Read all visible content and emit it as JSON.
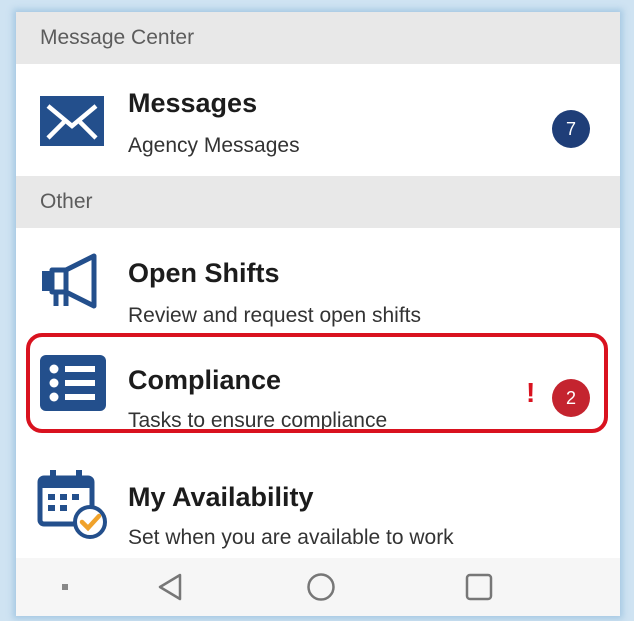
{
  "sections": {
    "message_center": "Message Center",
    "other": "Other"
  },
  "items": {
    "messages": {
      "title": "Messages",
      "subtitle": "Agency Messages",
      "badge": "7",
      "icon": "envelope-icon"
    },
    "open_shifts": {
      "title": "Open Shifts",
      "subtitle": "Review and request open shifts",
      "icon": "megaphone-icon"
    },
    "compliance": {
      "title": "Compliance",
      "subtitle": "Tasks to ensure compliance",
      "alert": "!",
      "badge": "2",
      "icon": "list-icon"
    },
    "availability": {
      "title": "My Availability",
      "subtitle": "Set when you are available to work",
      "icon": "calendar-check-icon"
    }
  },
  "colors": {
    "accent": "#234f8c",
    "badge_blue": "#1f3e78",
    "badge_red": "#c4242f",
    "highlight": "#d9121f",
    "availability_check": "#f0a22b"
  },
  "navbar": {
    "icons": [
      "menu-dot-icon",
      "back-icon",
      "home-icon",
      "recents-icon"
    ]
  }
}
